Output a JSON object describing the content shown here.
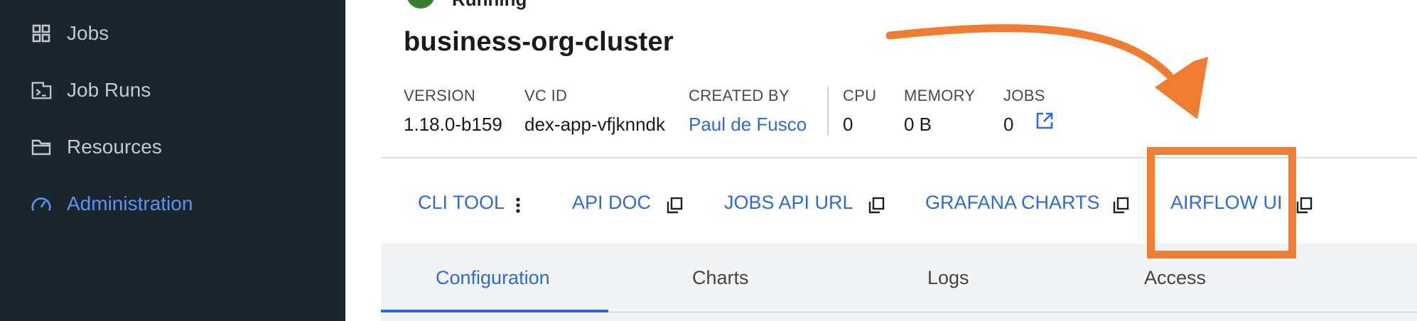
{
  "sidebar": {
    "items": [
      {
        "label": "Jobs",
        "icon": "grid-icon",
        "active": false
      },
      {
        "label": "Job Runs",
        "icon": "terminal-window-icon",
        "active": false
      },
      {
        "label": "Resources",
        "icon": "folder-icon",
        "active": false
      },
      {
        "label": "Administration",
        "icon": "speedometer-icon",
        "active": true
      }
    ]
  },
  "cluster": {
    "status": "Running",
    "name": "business-org-cluster",
    "meta": {
      "version_label": "VERSION",
      "version": "1.18.0-b159",
      "vcid_label": "VC ID",
      "vcid": "dex-app-vfjknndk",
      "created_by_label": "CREATED BY",
      "created_by": "Paul de Fusco",
      "cpu_label": "CPU",
      "cpu": "0",
      "memory_label": "MEMORY",
      "memory": "0 B",
      "jobs_label": "JOBS",
      "jobs": "0"
    }
  },
  "actions": {
    "cli_tool": "CLI TOOL",
    "api_doc": "API DOC",
    "jobs_api_url": "JOBS API URL",
    "grafana_charts": "GRAFANA CHARTS",
    "airflow_ui": "AIRFLOW UI"
  },
  "tabs": {
    "items": [
      "Configuration",
      "Charts",
      "Logs",
      "Access"
    ],
    "active": "Configuration"
  },
  "colors": {
    "sidebar_bg": "#1b252d",
    "accent": "#2f6bd0",
    "annotation": "#f07c32",
    "status_ok": "#3c7d32"
  }
}
